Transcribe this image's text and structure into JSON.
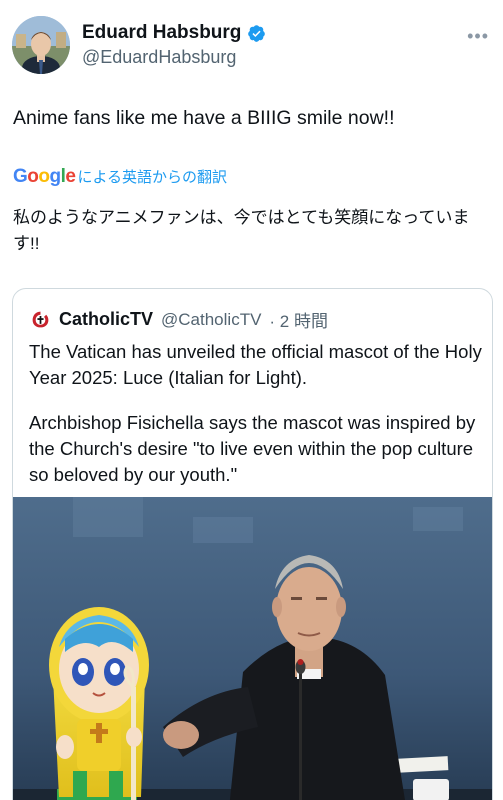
{
  "author": {
    "display_name": "Eduard Habsburg",
    "handle": "@EduardHabsburg",
    "verified": true,
    "avatar_icon": "profile-photo"
  },
  "tweet": {
    "text": "Anime fans like me have a BIIIG smile now!!"
  },
  "translation": {
    "provider_logo": "Google",
    "label": "による英語からの翻訳",
    "text": "私のようなアニメファンは、今ではとても笑顔になっています!!"
  },
  "quote": {
    "display_name": "CatholicTV",
    "handle": "@CatholicTV",
    "time_ago": "· 2 時間",
    "logo_icon": "catholictv-logo",
    "paragraphs": [
      "The Vatican has unveiled the official mascot of the Holy Year 2025: Luce (Italian for Light).",
      "Archbishop Fisichella says the mascot was inspired by the Church's desire \"to live even within the pop culture so beloved by our youth.\""
    ],
    "image_icon": "press-photo-mascot-and-archbishop"
  },
  "colors": {
    "accent": "#1d9bf0",
    "text": "#0f1419",
    "secondary_text": "#536471",
    "border": "#cfd9de",
    "google_blue": "#4285f4",
    "google_red": "#ea4335",
    "google_yellow": "#fbbc05",
    "google_green": "#34a853"
  }
}
